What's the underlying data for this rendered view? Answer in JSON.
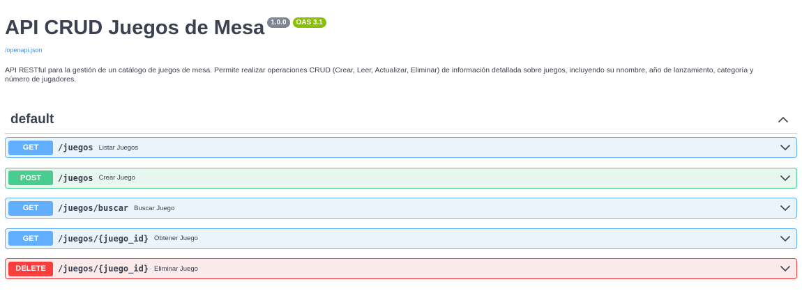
{
  "info": {
    "title": "API CRUD Juegos de Mesa",
    "version_badge": "1.0.0",
    "oas_badge": "OAS 3.1",
    "spec_link": "/openapi.json",
    "description": "API RESTful para la gestión de un catálogo de juegos de mesa. Permite realizar operaciones CRUD (Crear, Leer, Actualizar, Eliminar) de información detallada sobre juegos, incluyendo su nnombre, año de lanzamiento, categoría y número de jugadores."
  },
  "tag": {
    "name": "default",
    "toggle_icon": "chevron-up-icon"
  },
  "operations": [
    {
      "method": "GET",
      "path": "/juegos",
      "summary": "Listar Juegos",
      "color": "#61affe",
      "icon": "chevron-down-icon"
    },
    {
      "method": "POST",
      "path": "/juegos",
      "summary": "Crear Juego",
      "color": "#49cc90",
      "icon": "chevron-down-icon"
    },
    {
      "method": "GET",
      "path": "/juegos/buscar",
      "summary": "Buscar Juego",
      "color": "#61affe",
      "icon": "chevron-down-icon"
    },
    {
      "method": "GET",
      "path": "/juegos/{juego_id}",
      "summary": "Obtener Juego",
      "color": "#61affe",
      "icon": "chevron-down-icon"
    },
    {
      "method": "DELETE",
      "path": "/juegos/{juego_id}",
      "summary": "Eliminar Juego",
      "color": "#f93e3e",
      "icon": "chevron-down-icon"
    }
  ],
  "colors": {
    "get": "#61affe",
    "post": "#49cc90",
    "delete": "#f93e3e",
    "text": "#3b4151",
    "link": "#4990e2",
    "badge_version": "#7d8492",
    "badge_oas": "#89bf04"
  }
}
